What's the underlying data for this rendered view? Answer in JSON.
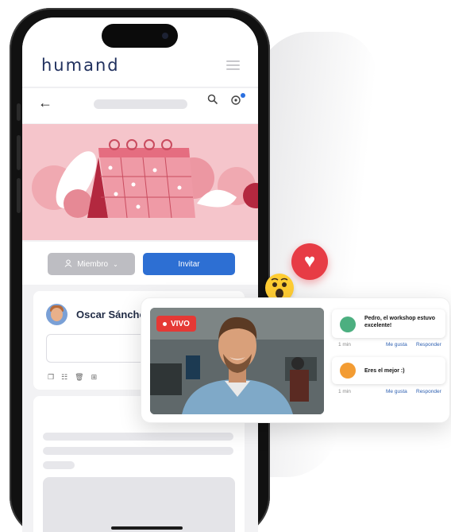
{
  "app": {
    "logo_text": "humand"
  },
  "colors": {
    "brand_blue": "#2d6fd3",
    "live_red": "#e53935",
    "banner_pink": "#f5c5cb",
    "heart_red": "#e73c45"
  },
  "community": {
    "member_button": "Miembro",
    "invite_button": "Invitar"
  },
  "post": {
    "author": "Oscar Sánchez"
  },
  "live_card": {
    "badge": "VIVO",
    "comments": [
      {
        "text": "Pedro, el workshop estuvo excelente!",
        "time": "1 min",
        "like": "Me gusta",
        "reply": "Responder"
      },
      {
        "text": "Eres el mejor :)",
        "time": "1 min",
        "like": "Me gusta",
        "reply": "Responder"
      }
    ]
  },
  "icons": [
    "back-arrow-icon",
    "search-icon",
    "notification-icon",
    "hamburger-menu-icon",
    "person-icon",
    "chevron-down-icon",
    "heart-icon",
    "wow-emoji-icon"
  ]
}
